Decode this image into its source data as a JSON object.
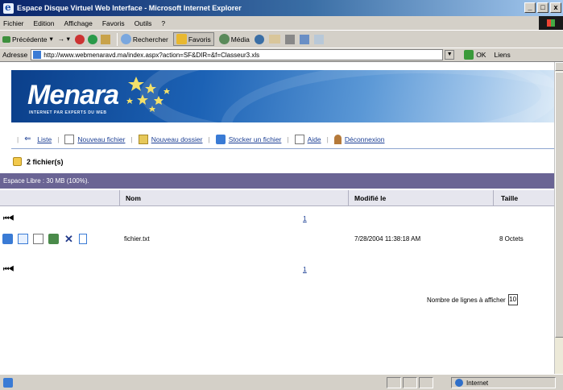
{
  "window": {
    "title": "Espace Disque Virtuel Web Interface - Microsoft Internet Explorer",
    "buttons": [
      "_",
      "□",
      "x"
    ]
  },
  "menu": [
    "Fichier",
    "Edition",
    "Affichage",
    "Favoris",
    "Outils",
    "?"
  ],
  "toolbar": {
    "back": "Précédente",
    "search": "Rechercher",
    "favorites": "Favoris",
    "media": "Média"
  },
  "address": {
    "label": "Adresse",
    "url": "http://www.webmenaravd.ma/index.aspx?action=SF&DIR=&f=Classeur3.xls",
    "go": "OK",
    "links": "Liens"
  },
  "banner": {
    "logo": "Menara",
    "tagline": "INTERNET PAR EXPERTS DU WEB"
  },
  "nav": {
    "items": [
      {
        "label": "Liste",
        "icon": "back-arrow-icon"
      },
      {
        "label": "Nouveau fichier",
        "icon": "new-file-icon"
      },
      {
        "label": "Nouveau dossier",
        "icon": "new-folder-icon"
      },
      {
        "label": "Stocker un fichier",
        "icon": "upload-icon"
      },
      {
        "label": "Aide",
        "icon": "help-icon"
      },
      {
        "label": "Déconnexion",
        "icon": "logout-icon"
      }
    ]
  },
  "files": {
    "count_label": "2 fichier(s)",
    "free_space": "Espace Libre : 30 MB (100%).",
    "columns": {
      "name": "Nom",
      "modified": "Modifié le",
      "size": "Taille"
    },
    "pager": {
      "first": "⏮◀",
      "page": "1"
    },
    "rows": [
      {
        "name": "fichier.txt",
        "modified": "7/28/2004 11:38:18 AM",
        "size": "8 Octets"
      }
    ],
    "lines_label": "Nombre de lignes à afficher",
    "lines_value": "10"
  },
  "status": {
    "zone": "Internet"
  },
  "colors": {
    "title_bar": "#0a246a",
    "free_bar": "#6a6494",
    "link": "#1c3f94",
    "banner": "#1c62b5"
  }
}
